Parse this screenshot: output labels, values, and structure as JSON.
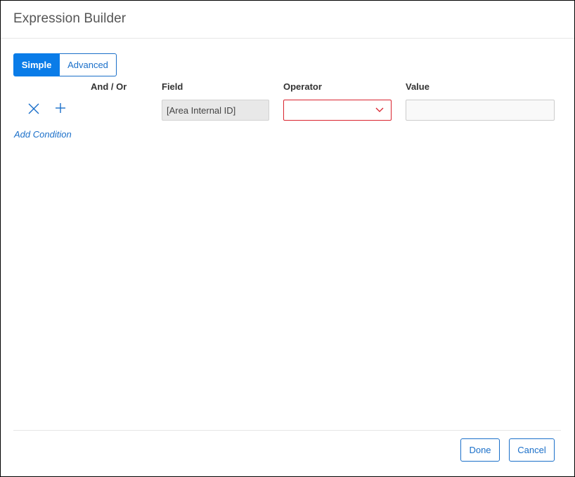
{
  "dialog": {
    "title": "Expression Builder"
  },
  "mode_toggle": {
    "simple_label": "Simple",
    "advanced_label": "Advanced",
    "selected": "Simple"
  },
  "columns": {
    "and_or": "And / Or",
    "field": "Field",
    "operator": "Operator",
    "value": "Value"
  },
  "conditions": [
    {
      "field": "[Area Internal ID]",
      "operator": "",
      "value": ""
    }
  ],
  "icons": {
    "remove": "close-icon",
    "add": "plus-icon",
    "dropdown": "chevron-down-icon"
  },
  "add_condition_label": "Add Condition",
  "footer": {
    "done_label": "Done",
    "cancel_label": "Cancel"
  },
  "colors": {
    "accent": "#0a7ce8",
    "link": "#1a6fc9",
    "error_border": "#d9232e"
  }
}
